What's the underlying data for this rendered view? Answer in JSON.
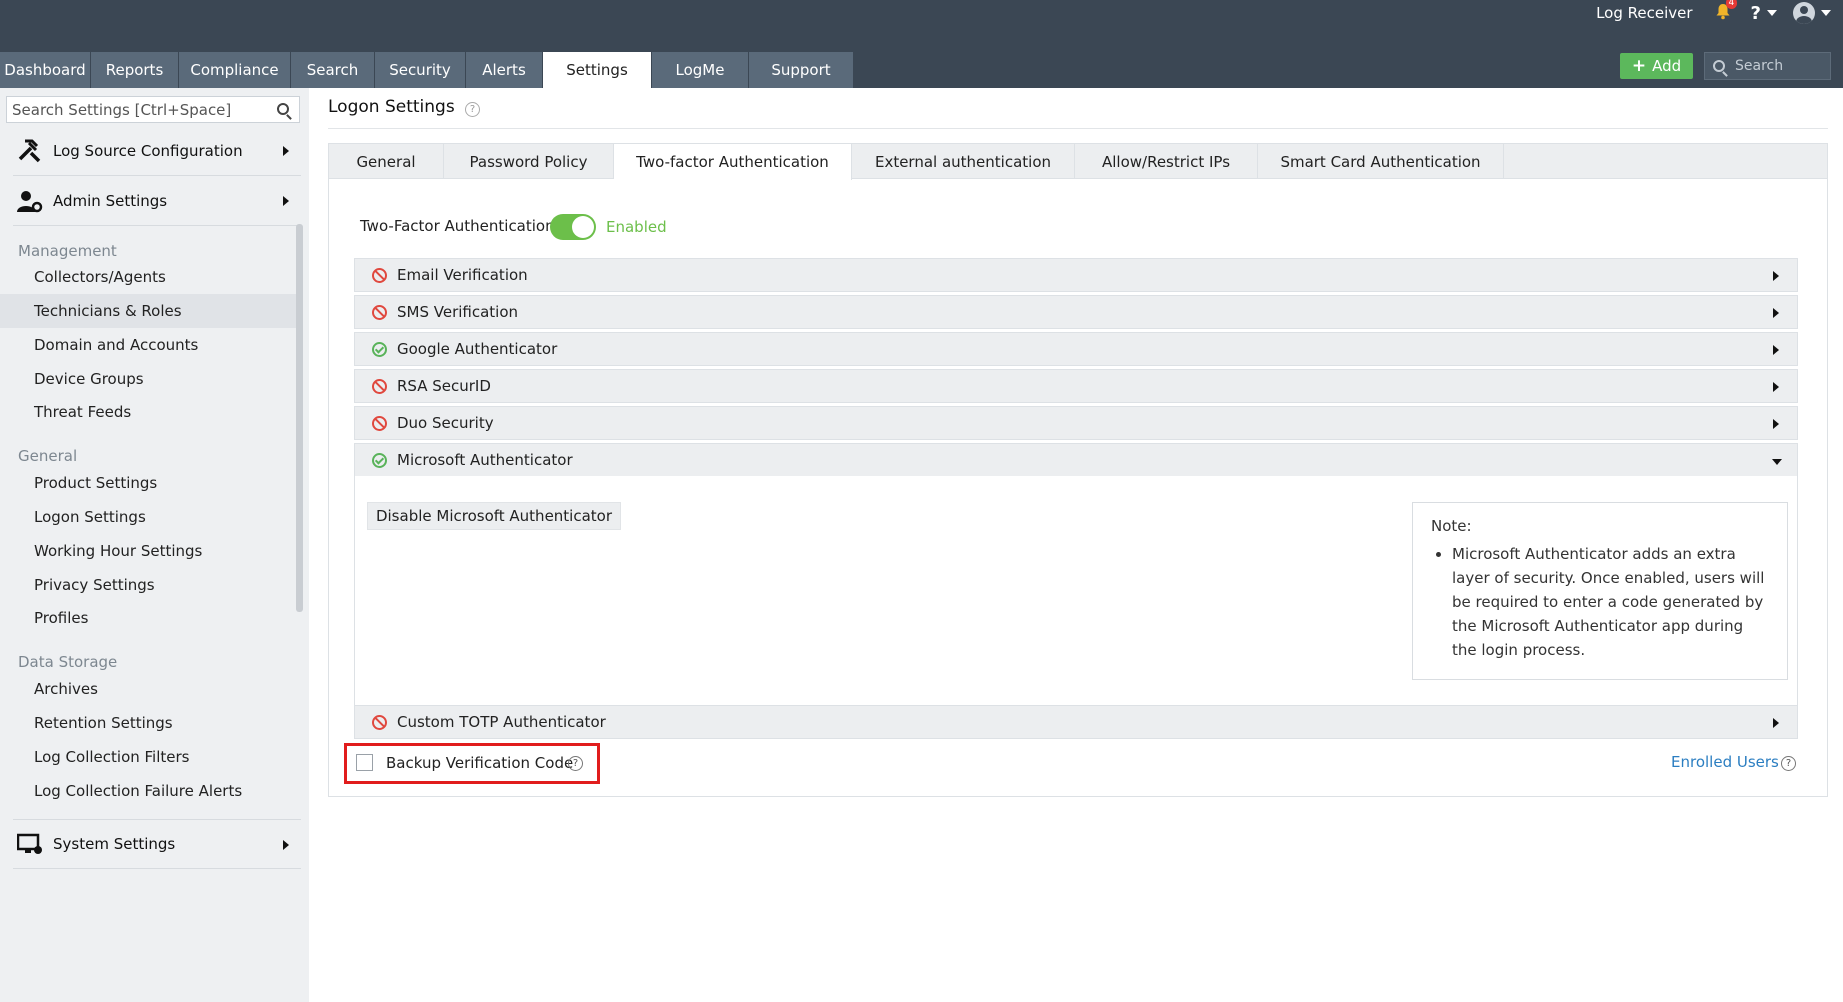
{
  "header": {
    "log_receiver": "Log Receiver",
    "notification_count": "4",
    "help": "?",
    "add_button": "Add",
    "search_placeholder": "Search",
    "nav_tabs": [
      {
        "label": "Dashboard",
        "active": false
      },
      {
        "label": "Reports",
        "active": false
      },
      {
        "label": "Compliance",
        "active": false
      },
      {
        "label": "Search",
        "active": false
      },
      {
        "label": "Security",
        "active": false
      },
      {
        "label": "Alerts",
        "active": false
      },
      {
        "label": "Settings",
        "active": true
      },
      {
        "label": "LogMe",
        "active": false
      },
      {
        "label": "Support",
        "active": false
      }
    ]
  },
  "sidebar": {
    "search_placeholder": "Search Settings [Ctrl+Space]",
    "groups": {
      "log_source": "Log Source Configuration",
      "admin": "Admin Settings",
      "system": "System Settings"
    },
    "sections": {
      "management": "Management",
      "general": "General",
      "data_storage": "Data Storage"
    },
    "management_items": [
      "Collectors/Agents",
      "Technicians & Roles",
      "Domain and Accounts",
      "Device Groups",
      "Threat Feeds"
    ],
    "general_items": [
      "Product Settings",
      "Logon Settings",
      "Working Hour Settings",
      "Privacy Settings",
      "Profiles"
    ],
    "data_storage_items": [
      "Archives",
      "Retention Settings",
      "Log Collection Filters",
      "Log Collection Failure Alerts"
    ]
  },
  "main": {
    "title": "Logon Settings",
    "help": "?",
    "subtabs": [
      {
        "label": "General",
        "active": false
      },
      {
        "label": "Password Policy",
        "active": false
      },
      {
        "label": "Two-factor Authentication",
        "active": true
      },
      {
        "label": "External authentication",
        "active": false
      },
      {
        "label": "Allow/Restrict IPs",
        "active": false
      },
      {
        "label": "Smart Card Authentication",
        "active": false
      }
    ],
    "tfa_label": "Two-Factor Authentication",
    "tfa_state": "Enabled",
    "methods": [
      {
        "label": "Email Verification",
        "enabled": false
      },
      {
        "label": "SMS Verification",
        "enabled": false
      },
      {
        "label": "Google Authenticator",
        "enabled": true
      },
      {
        "label": "RSA SecurID",
        "enabled": false
      },
      {
        "label": "Duo Security",
        "enabled": false
      },
      {
        "label": "Microsoft Authenticator",
        "enabled": true
      },
      {
        "label": "Custom TOTP Authenticator",
        "enabled": false
      }
    ],
    "disable_button": "Disable Microsoft Authenticator",
    "note_title": "Note:",
    "note_text": "Microsoft Authenticator adds an extra layer of security. Once enabled, users will be required to enter a code generated by the Microsoft Authenticator app during the login process.",
    "backup_label": "Backup Verification Code",
    "backup_checked": false,
    "enrolled_users": "Enrolled Users"
  },
  "colors": {
    "header_bg": "#3b4754",
    "nav_tab_bg": "#5a6a7a",
    "add_green": "#5cb85c",
    "toggle_green": "#6cbf4a",
    "status_off": "#e0483e",
    "status_on": "#59b35a",
    "highlight_red": "#e11d1d",
    "link_blue": "#2b7ec1"
  }
}
